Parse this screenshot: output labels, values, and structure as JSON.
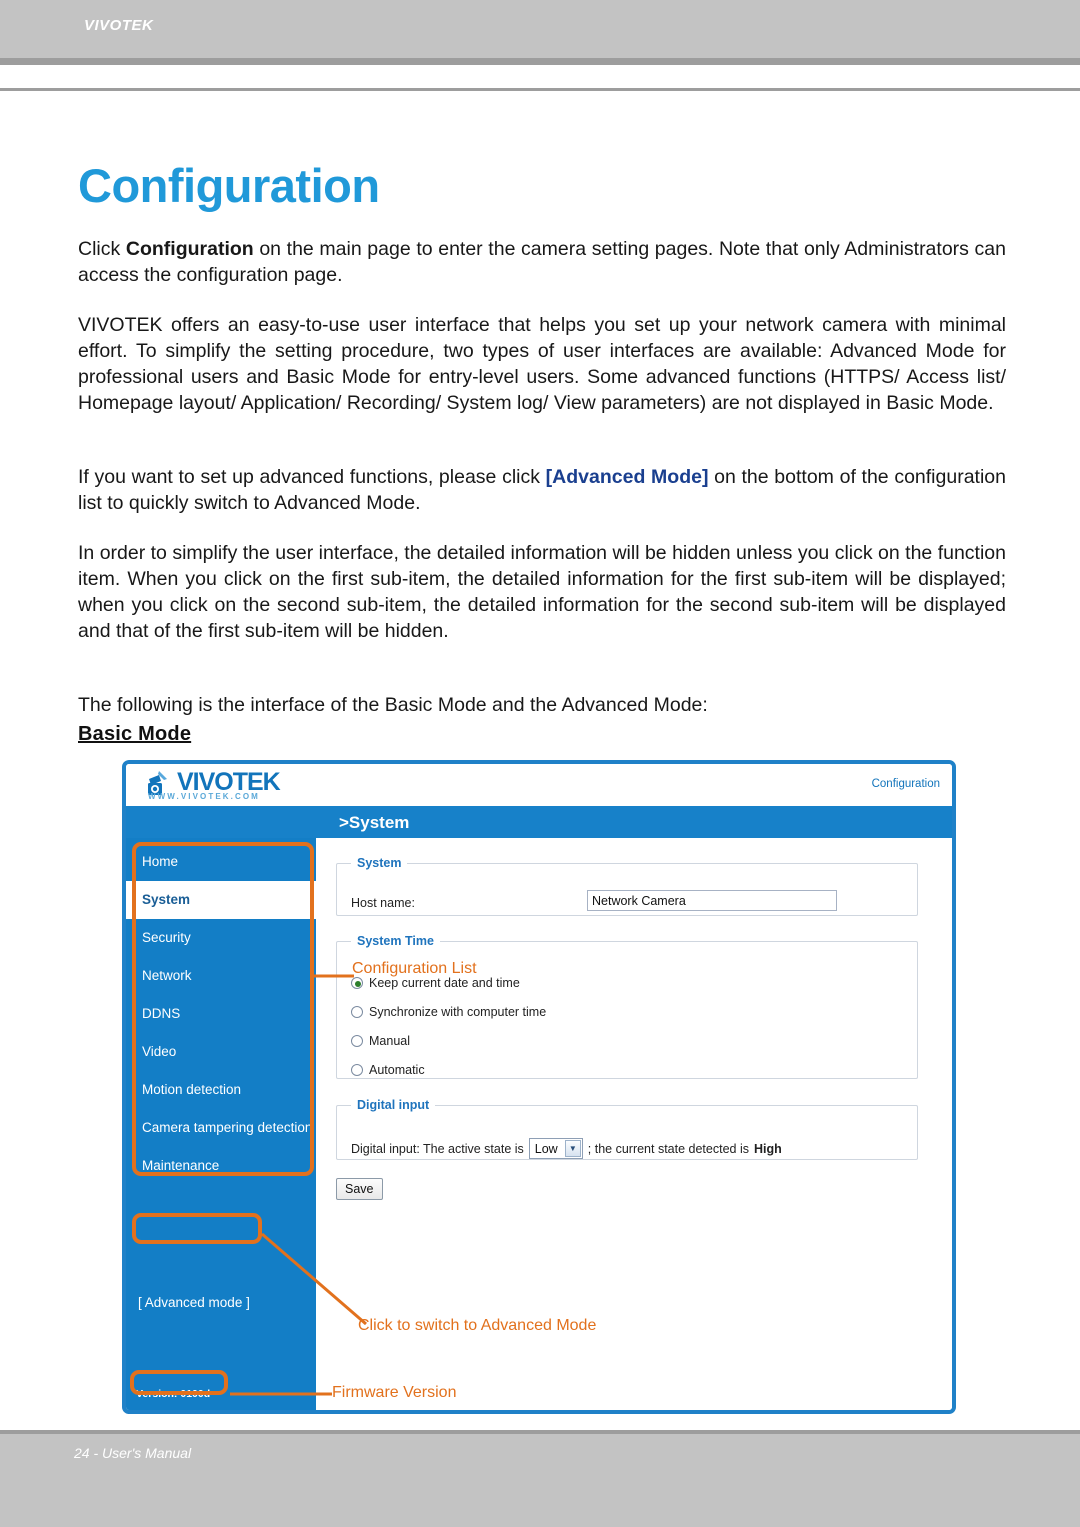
{
  "header": {
    "brand": "VIVOTEK"
  },
  "page_title": "Configuration",
  "paragraphs": {
    "p1_a": "Click ",
    "p1_b": "Configuration",
    "p1_c": " on the main page to enter the camera setting pages. Note that only Administrators can access the configuration page.",
    "p2": "VIVOTEK offers an easy-to-use user interface that helps you set up your network camera with minimal effort. To simplify the setting procedure, two types of user interfaces are available: Advanced Mode for professional users and Basic Mode for entry-level users. Some advanced functions (HTTPS/ Access list/ Homepage layout/ Application/ Recording/ System log/ View parameters) are not displayed in Basic Mode.",
    "p3_a": "If you want to set up advanced functions, please click ",
    "p3_b": "[Advanced Mode]",
    "p3_c": " on the bottom of the configuration list to quickly switch to Advanced Mode.",
    "p4": "In order to simplify the user interface, the detailed information will be hidden unless you click on the function item. When you click on the first sub-item, the detailed information for the first sub-item will be displayed; when you click on the second sub-item, the detailed information for the second sub-item will be displayed and that of the first sub-item will be hidden.",
    "p5": "The following is the interface of the Basic Mode and the Advanced Mode:"
  },
  "subhead": "Basic Mode",
  "screenshot": {
    "logo_word": "VIVOTEK",
    "logo_url": "WWW.VIVOTEK.COM",
    "config_link": "Configuration",
    "breadcrumb": ">System",
    "menu": [
      {
        "label": "Home",
        "active": false
      },
      {
        "label": "System",
        "active": true
      },
      {
        "label": "Security",
        "active": false
      },
      {
        "label": "Network",
        "active": false
      },
      {
        "label": "DDNS",
        "active": false
      },
      {
        "label": "Video",
        "active": false
      },
      {
        "label": "Motion detection",
        "active": false
      },
      {
        "label": "Camera tampering detection",
        "active": false
      },
      {
        "label": "Maintenance",
        "active": false
      }
    ],
    "advanced_mode": "[ Advanced mode ]",
    "version": "Version: 0100d",
    "system": {
      "legend": "System",
      "host_label": "Host name:",
      "host_value": "Network Camera"
    },
    "system_time": {
      "legend": "System Time",
      "options": [
        {
          "label": "Keep current date and time",
          "selected": true
        },
        {
          "label": "Synchronize with computer time",
          "selected": false
        },
        {
          "label": "Manual",
          "selected": false
        },
        {
          "label": "Automatic",
          "selected": false
        }
      ]
    },
    "digital_input": {
      "legend": "Digital input",
      "text_before": "Digital input: The active state is",
      "select_value": "Low",
      "text_middle": "; the current state detected is",
      "state_value": "High"
    },
    "save_label": "Save"
  },
  "annotations": {
    "configuration_list": "Configuration List",
    "switch_advanced": "Click to switch to Advanced Mode",
    "firmware_version": "Firmware Version",
    "color": "#e2711d"
  },
  "footer": {
    "page": "24 - User's Manual"
  },
  "colors": {
    "title_blue": "#2099d9",
    "header_gray": "#c3c3c3",
    "ui_blue": "#137ec6",
    "frame_blue": "#1f81c8",
    "annotation_orange": "#e2711d",
    "link_navy": "#1a3f8f"
  }
}
